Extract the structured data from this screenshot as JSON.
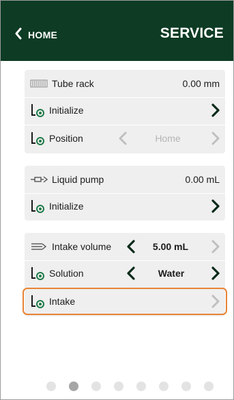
{
  "header": {
    "back_label": "HOME",
    "title": "SERVICE"
  },
  "tube_card": {
    "title_row": {
      "label": "Tube rack",
      "value": "0.00 mm",
      "icon": "tube-rack-icon"
    },
    "initialize_row": {
      "label": "Initialize",
      "icon": "axis-point-icon"
    },
    "position_row": {
      "label": "Position",
      "value": "Home",
      "icon": "axis-point-icon"
    }
  },
  "pump_card": {
    "title_row": {
      "label": "Liquid pump",
      "value": "0.00 mL",
      "icon": "liquid-pump-icon"
    },
    "initialize_row": {
      "label": "Initialize",
      "icon": "axis-point-icon"
    }
  },
  "intake_card": {
    "volume_row": {
      "label": "Intake volume",
      "value": "5.00 mL",
      "icon": "intake-volume-icon"
    },
    "solution_row": {
      "label": "Solution",
      "value": "Water",
      "icon": "axis-point-icon"
    },
    "intake_row": {
      "label": "Intake",
      "icon": "axis-point-icon"
    }
  },
  "pagination": {
    "count": 8,
    "active_index": 1
  },
  "colors": {
    "header_bg": "#0d3b24",
    "accent_green": "#1e7a48",
    "highlight_orange": "#e88334",
    "card_bg": "#efefef",
    "chevron_active": "#0b2a1a",
    "chevron_disabled": "#bfbfbf"
  }
}
